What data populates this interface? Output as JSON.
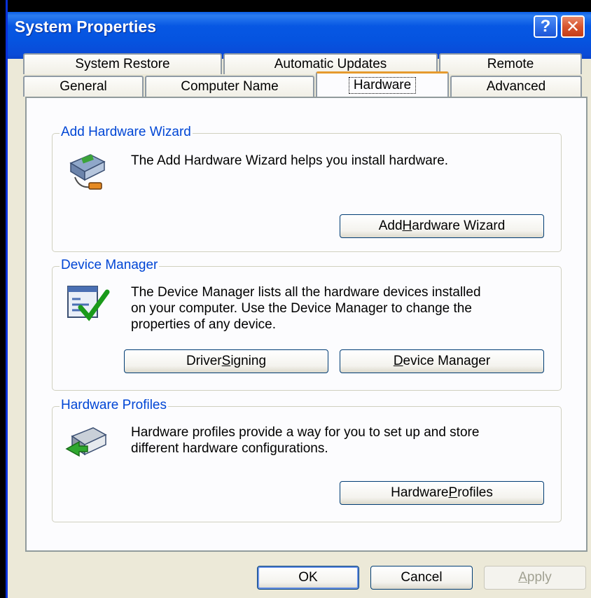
{
  "window": {
    "title": "System Properties",
    "help_glyph": "?",
    "close_glyph": "✕"
  },
  "tabs": {
    "row_back": [
      "System Restore",
      "Automatic Updates",
      "Remote"
    ],
    "row_front": [
      "General",
      "Computer Name",
      "Hardware",
      "Advanced"
    ],
    "selected": "Hardware"
  },
  "groups": {
    "add_hardware": {
      "legend": "Add Hardware Wizard",
      "text": "The Add Hardware Wizard helps you install hardware.",
      "button_pre": "Add ",
      "button_key": "H",
      "button_post": "ardware Wizard",
      "icon": "add-hardware-icon"
    },
    "device_manager": {
      "legend": "Device Manager",
      "text_line1": "The Device Manager lists all the hardware devices installed",
      "text_line2": "on your computer. Use the Device Manager to change the",
      "text_line3": "properties of any device.",
      "driver_pre": "Driver ",
      "driver_key": "S",
      "driver_post": "igning",
      "dm_key": "D",
      "dm_post": "evice Manager",
      "icon": "device-manager-icon"
    },
    "hardware_profiles": {
      "legend": "Hardware Profiles",
      "text_line1": "Hardware profiles provide a way for you to set up and store",
      "text_line2": "different hardware configurations.",
      "button_pre": "Hardware ",
      "button_key": "P",
      "button_post": "rofiles",
      "icon": "hardware-profiles-icon"
    }
  },
  "footer": {
    "ok": "OK",
    "cancel": "Cancel",
    "apply_key": "A",
    "apply_post": "pply"
  },
  "colors": {
    "titlebar": "#0554e0",
    "legend": "#0046d5",
    "selected_tab_accent": "#e69a2e"
  }
}
